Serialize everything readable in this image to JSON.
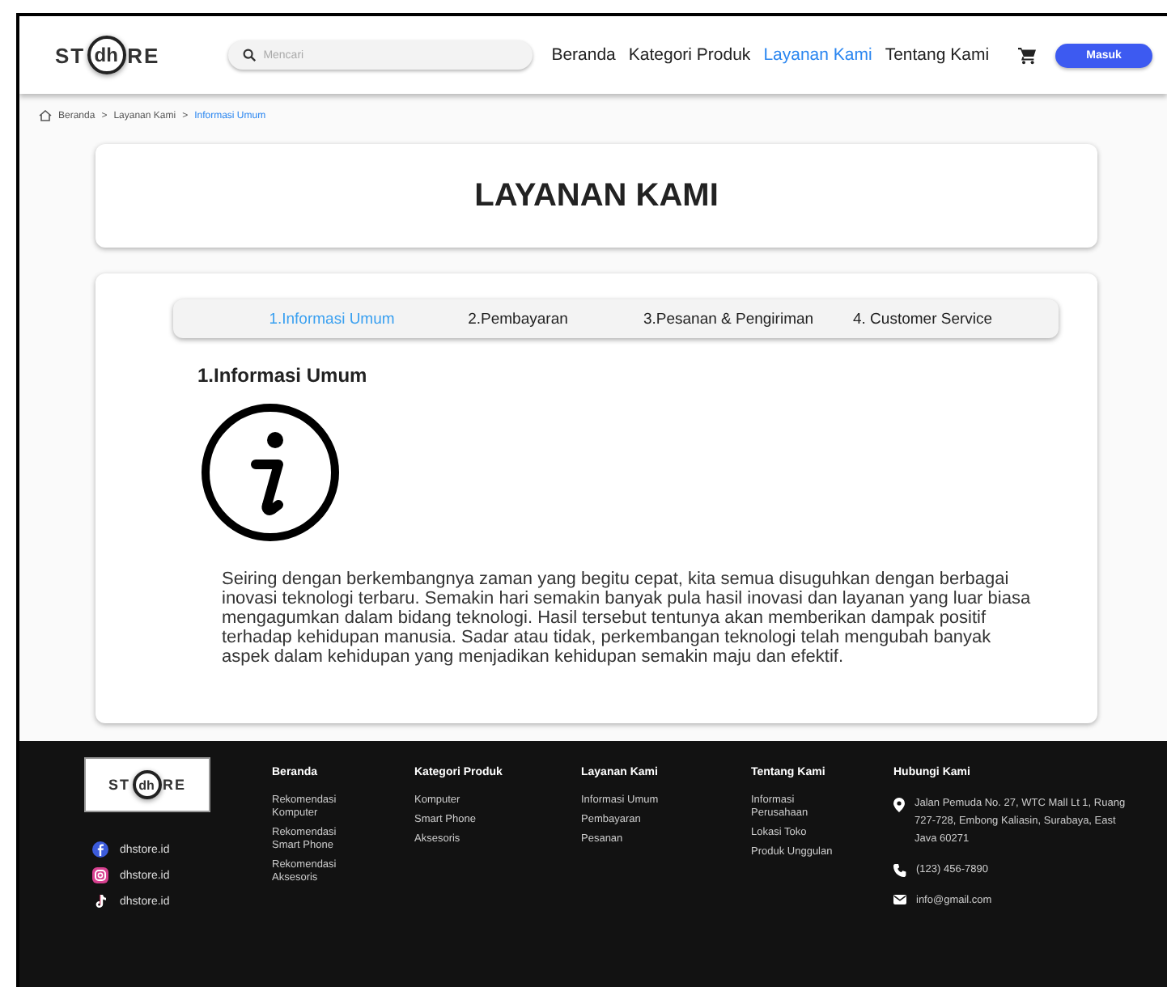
{
  "header": {
    "logo": {
      "left": "ST",
      "mark": "dh",
      "right": "RE"
    },
    "search": {
      "placeholder": "Mencari"
    },
    "nav": [
      {
        "label": "Beranda",
        "selected": false
      },
      {
        "label": "Kategori Produk",
        "selected": false
      },
      {
        "label": "Layanan Kami",
        "selected": true
      },
      {
        "label": "Tentang Kami",
        "selected": false
      }
    ],
    "login_button": "Masuk"
  },
  "breadcrumb": [
    {
      "label": "Beranda",
      "current": false
    },
    {
      "label": "Layanan Kami",
      "current": false
    },
    {
      "label": "Informasi Umum",
      "current": true
    }
  ],
  "breadcrumb_separator": ">",
  "page_title": "LAYANAN KAMI",
  "tabs": [
    {
      "label": "1.Informasi Umum",
      "selected": true
    },
    {
      "label": "2.Pembayaran",
      "selected": false
    },
    {
      "label": "3.Pesanan & Pengiriman",
      "selected": false
    },
    {
      "label": "4. Customer Service",
      "selected": false
    }
  ],
  "section": {
    "heading": "1.Informasi Umum",
    "body": "Seiring dengan berkembangnya zaman yang begitu cepat, kita semua disuguhkan dengan berbagai inovasi teknologi terbaru. Semakin hari semakin banyak pula hasil inovasi dan layanan yang luar biasa mengagumkan dalam bidang teknologi. Hasil tersebut tentunya akan memberikan dampak positif terhadap kehidupan manusia. Sadar atau tidak, perkembangan teknologi telah mengubah banyak aspek dalam kehidupan yang menjadikan kehidupan semakin maju dan efektif."
  },
  "footer": {
    "logo": {
      "left": "ST",
      "mark": "dh",
      "right": "RE"
    },
    "socials": [
      {
        "kind": "facebook",
        "handle": "dhstore.id"
      },
      {
        "kind": "instagram",
        "handle": "dhstore.id"
      },
      {
        "kind": "tiktok",
        "handle": "dhstore.id"
      }
    ],
    "columns": [
      {
        "title": "Beranda",
        "links": [
          "Rekomendasi Komputer",
          "Rekomendasi Smart Phone",
          "Rekomendasi Aksesoris"
        ]
      },
      {
        "title": "Kategori Produk",
        "links": [
          "Komputer",
          "Smart Phone",
          "Aksesoris"
        ]
      },
      {
        "title": "Layanan Kami",
        "links": [
          "Informasi Umum",
          "Pembayaran",
          "Pesanan"
        ]
      },
      {
        "title": "Tentang Kami",
        "links": [
          "Informasi Perusahaan",
          "Lokasi Toko",
          "Produk Unggulan"
        ]
      }
    ],
    "contact": {
      "title": "Hubungi Kami",
      "items": [
        {
          "kind": "address",
          "text": "Jalan Pemuda No. 27, WTC Mall Lt 1, Ruang 727-728, Embong Kaliasin, Surabaya, East Java 60271"
        },
        {
          "kind": "phone",
          "text": "(123) 456-7890"
        },
        {
          "kind": "email",
          "text": "info@gmail.com"
        }
      ]
    }
  }
}
